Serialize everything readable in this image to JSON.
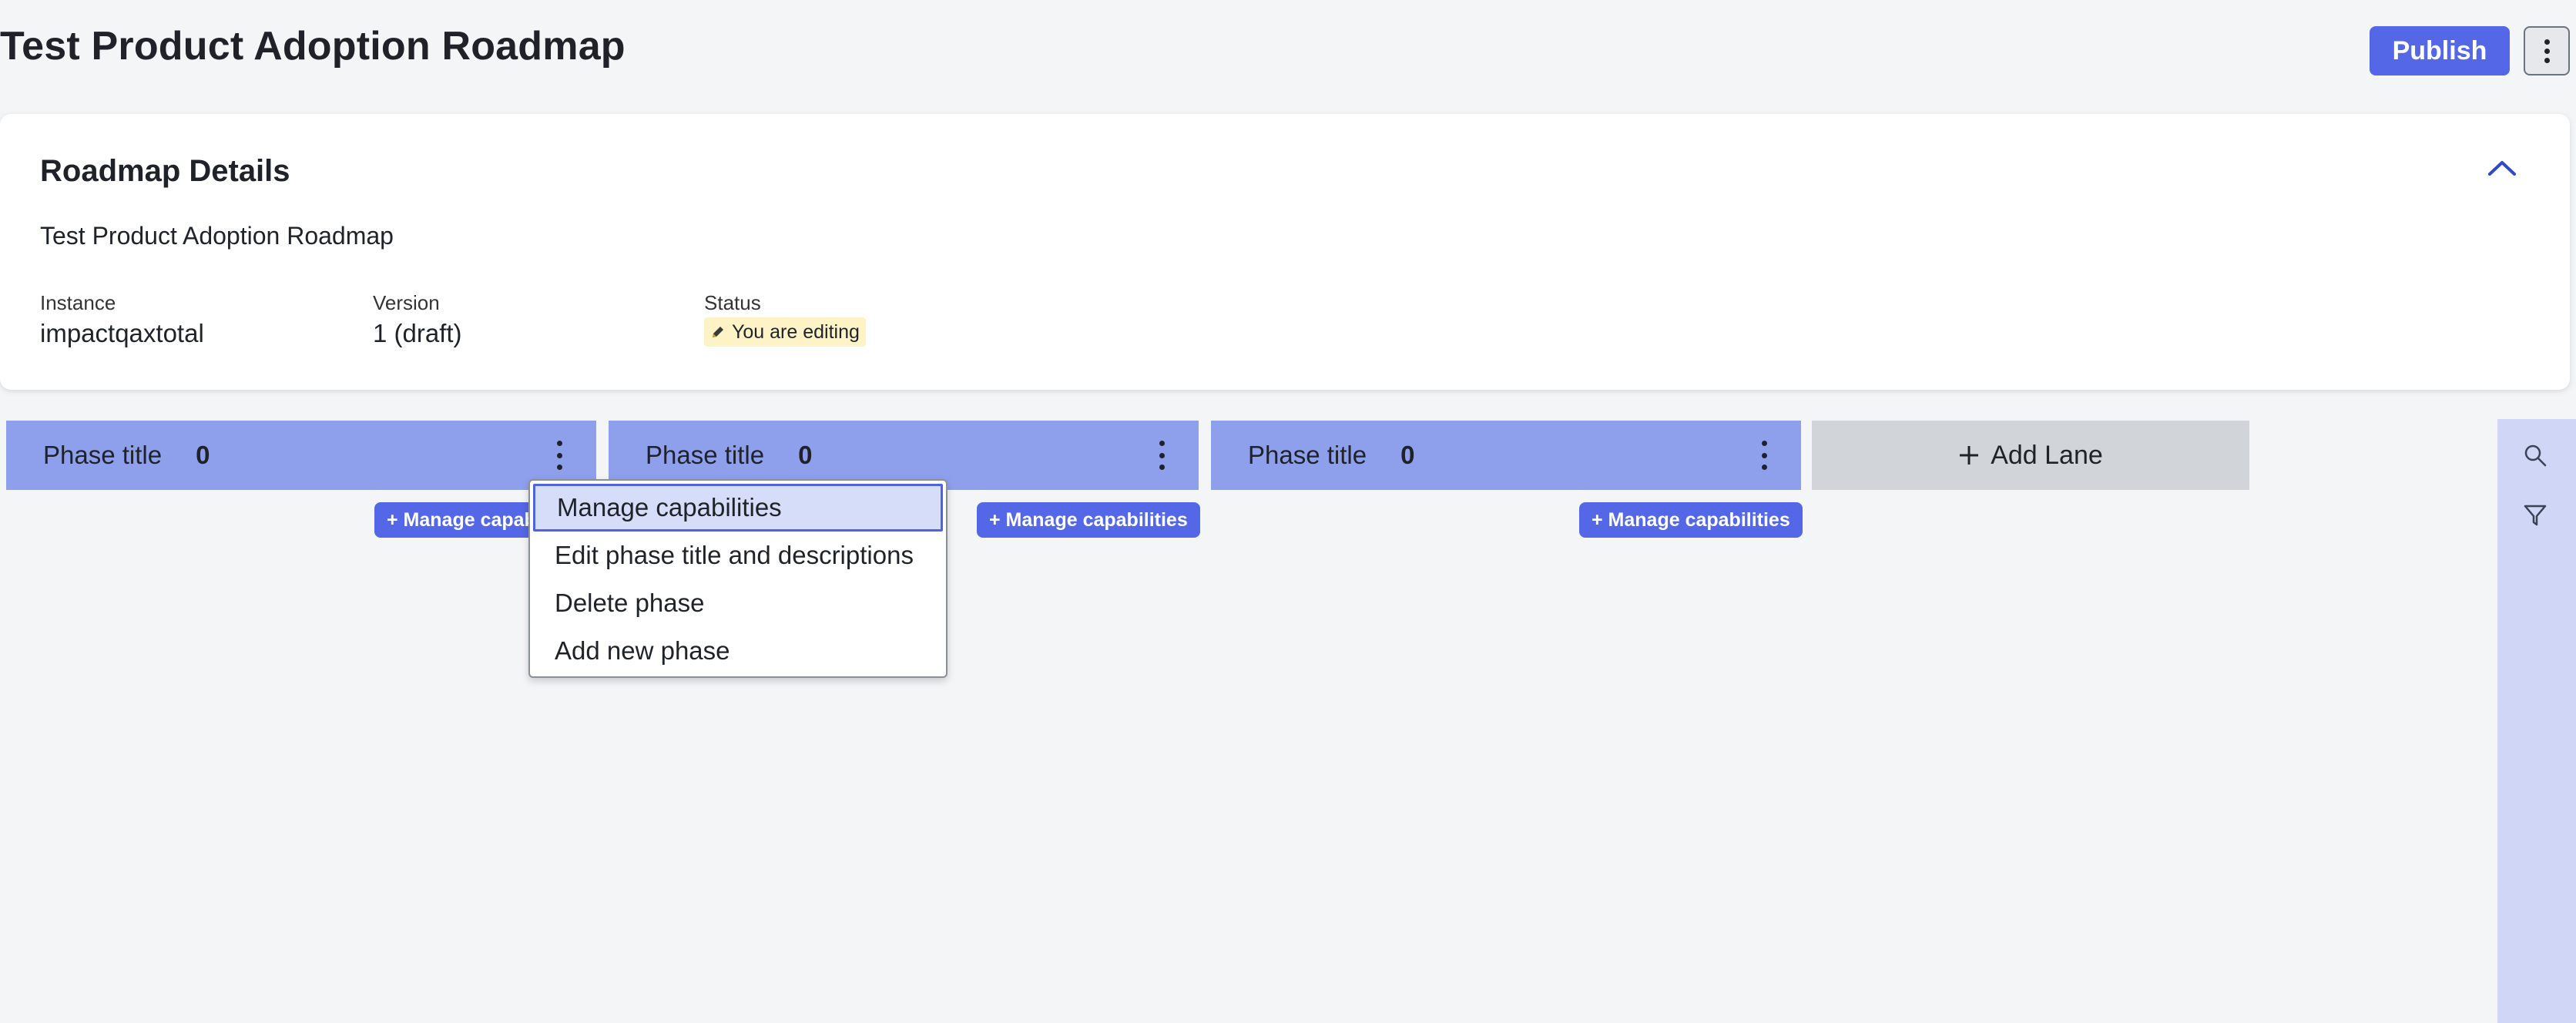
{
  "header": {
    "title": "Test Product Adoption Roadmap",
    "publish_label": "Publish",
    "more_icon": "more-vertical-icon"
  },
  "details": {
    "heading": "Roadmap Details",
    "description": "Test Product Adoption Roadmap",
    "instance_label": "Instance",
    "instance_value": "impactqaxtotal",
    "version_label": "Version",
    "version_value": "1 (draft)",
    "status_label": "Status",
    "status_value": "You are editing",
    "status_icon": "pencil-icon",
    "status_color": "#fdf3c7",
    "collapse_icon": "chevron-up-icon"
  },
  "phases": [
    {
      "title": "Phase title",
      "count": "0",
      "manage_label": "+ Manage capabilities"
    },
    {
      "title": "Phase title",
      "count": "0",
      "manage_label": "+ Manage capabilities"
    },
    {
      "title": "Phase title",
      "count": "0",
      "manage_label": "+ Manage capabilities"
    }
  ],
  "add_lane_label": "Add Lane",
  "phase_menu": {
    "items": [
      "Manage capabilities",
      "Edit phase title and descriptions",
      "Delete phase",
      "Add new phase"
    ],
    "selected": "Manage capabilities"
  },
  "side_rail": {
    "icons": [
      "search-icon",
      "filter-icon"
    ]
  },
  "colors": {
    "accent": "#5468e7",
    "phase_header": "#8e9fec",
    "add_lane_bg": "#d1d5d9",
    "side_rail_bg": "#cfd6f6",
    "page_bg": "#f4f5f7"
  }
}
